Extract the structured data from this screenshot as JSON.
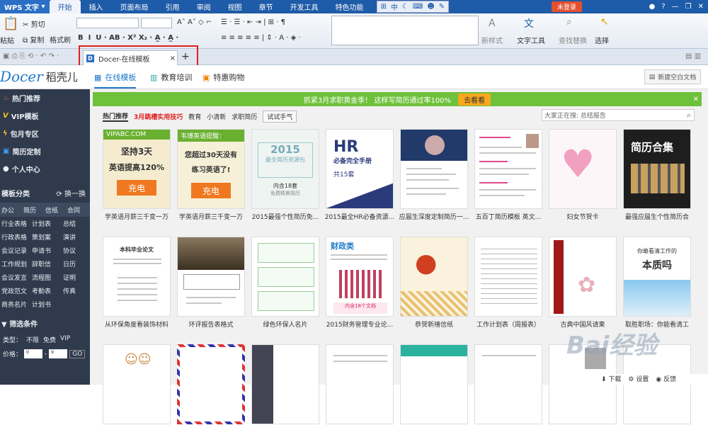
{
  "menubar": {
    "app": "WPS 文字",
    "tabs": [
      "开始",
      "插入",
      "页面布局",
      "引用",
      "审阅",
      "视图",
      "章节",
      "开发工具",
      "特色功能"
    ],
    "quick": "中",
    "login": "未登录"
  },
  "ribbon": {
    "paste": "粘贴",
    "cut": "剪切",
    "copy": "复制",
    "format_painter": "格式刷",
    "new_style": "新样式",
    "text_tools": "文字工具",
    "find_replace": "查找替换",
    "select": "选择"
  },
  "tabbar": {
    "doc_tab": "Docer-在线模板",
    "close": "×",
    "add": "+"
  },
  "docer": {
    "logo": "Docer",
    "logo_cn": "稻壳儿",
    "nav": [
      "在线模板",
      "教育培训",
      "特惠购物"
    ],
    "new_doc": "新建空白文档"
  },
  "sidebar": {
    "items": [
      "热门推荐",
      "VIP模板",
      "包月专区",
      "简历定制",
      "个人中心"
    ],
    "category_title": "模板分类",
    "switch": "换一换",
    "cat_head": [
      "办公",
      "简历",
      "信纸",
      "合同"
    ],
    "cat_rows": [
      [
        "行业表格",
        "计划表",
        "总结"
      ],
      [
        "行政表格",
        "策划案",
        "演讲"
      ],
      [
        "会议记录",
        "申请书",
        "协议"
      ],
      [
        "工作规划",
        "辞职信",
        "日历"
      ],
      [
        "会议发言",
        "流程图",
        "证明"
      ],
      [
        "党政范文",
        "考勤表",
        "传真"
      ],
      [
        "商务名片",
        "计划书",
        ""
      ]
    ],
    "filter_title": "筛选条件",
    "type_label": "类型：",
    "type_opts": [
      "不限",
      "免费",
      "VIP"
    ],
    "price_label": "价格：",
    "price_from": "¥",
    "price_to": "¥",
    "go": "GO"
  },
  "main": {
    "promo": "抓紧3月求职黄金季！ 这样写简历通过率100%",
    "promo_btn": "去看看",
    "filters": [
      "热门推荐",
      "3月跳槽实用技巧",
      "教育",
      "小清新",
      "求职简历"
    ],
    "try_btn": "试试手气",
    "search_placeholder": "大家正在搜: 总结报告",
    "row1": [
      "学英语月薪三千变一万",
      "学英语月薪三千变一万",
      "2015最强个性简历免...",
      "2015最全HR必备资源...",
      "应届生深度定制简历一...",
      "五百丁简历模板 英文...",
      "妇女节贺卡",
      "最强应届生个性简历合"
    ],
    "row2": [
      "从环保角度看装饰材料",
      "环评报告表格式",
      "绿色环保人名片",
      "2015财务管理专业论...",
      "恭贺新禧信纸",
      "工作计划表（周报表）",
      "古典中国风请柬",
      "取胜职场：你能看清工"
    ],
    "thumb1_top": "VIPABC.COM",
    "thumb1_l1": "坚持3天",
    "thumb1_l2": "英语提高120%",
    "thumb1_btn": "充电",
    "thumb2_top": "韦博英语提醒：",
    "thumb2_l1": "您超过30天没有",
    "thumb2_l2": "练习英语了!",
    "thumb2_btn": "充电",
    "thumb3_big": "2015",
    "thumb3_sub": "最全简历资源包",
    "thumb3_count": "内含18套",
    "thumb3_note": "免费精美简历",
    "thumb4_big": "HR",
    "thumb4_sub": "必备完全手册",
    "thumb4_count": "共15套",
    "thumb8_title": "简历合集",
    "thumb12_title": "财政类",
    "thumb16_l1": "你敢看清工作的",
    "thumb16_l2": "本质吗",
    "thumb9_title": "本科毕业论文"
  },
  "watermark": "Bai经验",
  "bottom": [
    "下载",
    "设置",
    "反馈"
  ]
}
